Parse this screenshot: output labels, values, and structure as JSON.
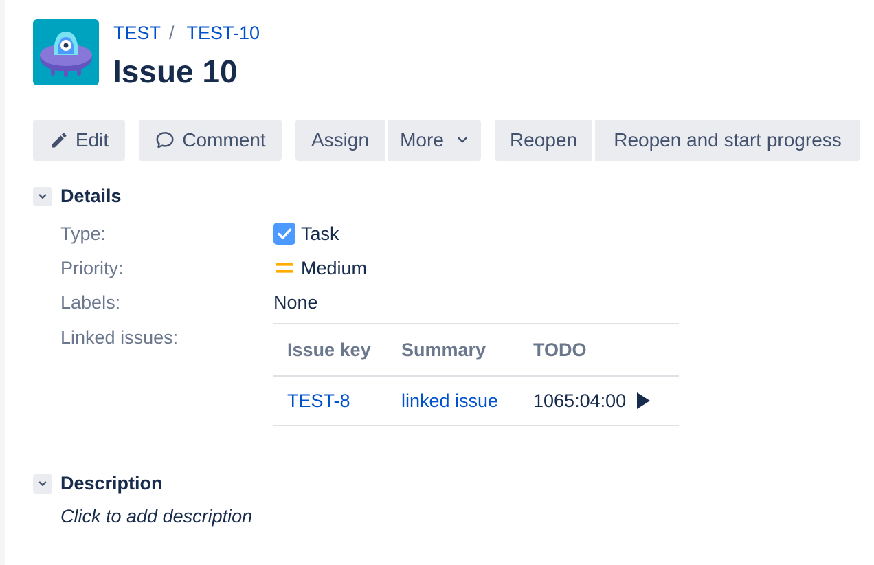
{
  "breadcrumb": {
    "project": "TEST",
    "separator": "/",
    "issue_key": "TEST-10"
  },
  "issue": {
    "title": "Issue 10"
  },
  "toolbar": {
    "edit_label": "Edit",
    "comment_label": "Comment",
    "assign_label": "Assign",
    "more_label": "More",
    "reopen_label": "Reopen",
    "reopen_start_label": "Reopen and start progress"
  },
  "details": {
    "title": "Details",
    "type_label": "Type:",
    "type_value": "Task",
    "priority_label": "Priority:",
    "priority_value": "Medium",
    "labels_label": "Labels:",
    "labels_value": "None",
    "linked_label": "Linked issues:"
  },
  "linked_issues": {
    "columns": [
      "Issue key",
      "Summary",
      "TODO"
    ],
    "rows": [
      {
        "key": "TEST-8",
        "summary": "linked issue",
        "todo": "1065:04:00"
      }
    ]
  },
  "description": {
    "title": "Description",
    "placeholder": "Click to add description"
  },
  "colors": {
    "link": "#0052cc",
    "button_bg": "#ebecf0",
    "task_icon": "#4c9aff",
    "priority_medium": "#ffab00",
    "avatar_bg": "#00a3bf"
  }
}
